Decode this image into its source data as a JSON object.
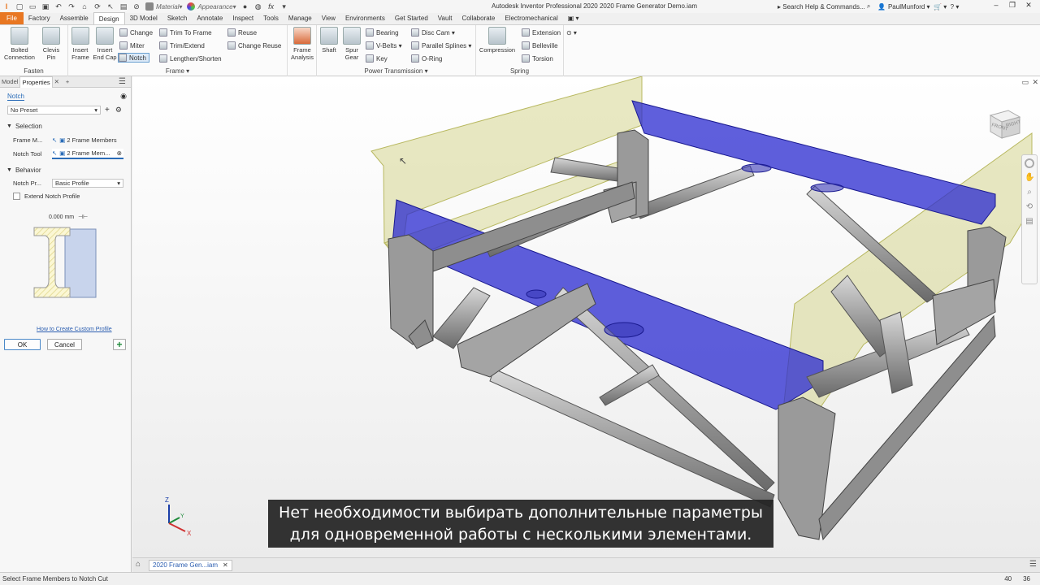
{
  "app": {
    "material_label": "Material",
    "appearance_label": "Appearance",
    "title": "Autodesk Inventor Professional 2020   2020 Frame Generator Demo.iam",
    "search_placeholder": "Search Help & Commands...",
    "user": "PaulMunford"
  },
  "tabs": [
    "File",
    "Factory",
    "Assemble",
    "Design",
    "3D Model",
    "Sketch",
    "Annotate",
    "Inspect",
    "Tools",
    "Manage",
    "View",
    "Environments",
    "Get Started",
    "Vault",
    "Collaborate",
    "Electromechanical"
  ],
  "ribbon": {
    "fasten": {
      "title": "Fasten",
      "bolted": "Bolted Connection",
      "clevis": "Clevis Pin"
    },
    "frame": {
      "title": "Frame",
      "insert_frame": "Insert Frame",
      "insert_endcap": "Insert End Cap",
      "change": "Change",
      "miter": "Miter",
      "notch": "Notch",
      "trim_to_frame": "Trim To Frame",
      "trim_extend": "Trim/Extend",
      "lengthen": "Lengthen/Shorten",
      "reuse": "Reuse",
      "change_reuse": "Change Reuse"
    },
    "frame_analysis": "Frame Analysis",
    "power": {
      "title": "Power Transmission",
      "shaft": "Shaft",
      "spur_gear": "Spur Gear",
      "bearing": "Bearing",
      "vbelts": "V-Belts",
      "key": "Key",
      "disc_cam": "Disc Cam",
      "parallel_splines": "Parallel Splines",
      "oring": "O-Ring"
    },
    "spring": {
      "title": "Spring",
      "compression": "Compression",
      "extension": "Extension",
      "belleville": "Belleville",
      "torsion": "Torsion"
    }
  },
  "panel": {
    "tab_model": "Model",
    "tab_properties": "Properties",
    "title": "Notch",
    "preset": "No Preset",
    "selection_header": "Selection",
    "frame_members_label": "Frame M...",
    "frame_members_value": "2 Frame Members",
    "notch_tool_label": "Notch Tool",
    "notch_tool_value": "2 Frame Mem...",
    "behavior_header": "Behavior",
    "notch_profile_label": "Notch Pr...",
    "notch_profile_value": "Basic Profile",
    "extend_label": "Extend Notch Profile",
    "offset_value": "0.000 mm",
    "help_link": "How to Create Custom Profile",
    "ok": "OK",
    "cancel": "Cancel"
  },
  "viewcube": {
    "front": "FRONT",
    "right": "RIGHT"
  },
  "axes": {
    "z": "Z",
    "y": "Y",
    "x": "X"
  },
  "subtitle": {
    "line1": "Нет необходимости выбирать дополнительные параметры",
    "line2": "для одновременной работы с несколькими элементами."
  },
  "doc_tab": "2020 Frame Gen...iam",
  "status": {
    "message": "Select Frame Members to Notch Cut",
    "num1": "40",
    "num2": "36"
  },
  "colors": {
    "file_tab": "#e87722",
    "selected_blue": "#2a2ad0",
    "selected_yellow": "#d8d88a",
    "tube": "#a9a9a9"
  }
}
